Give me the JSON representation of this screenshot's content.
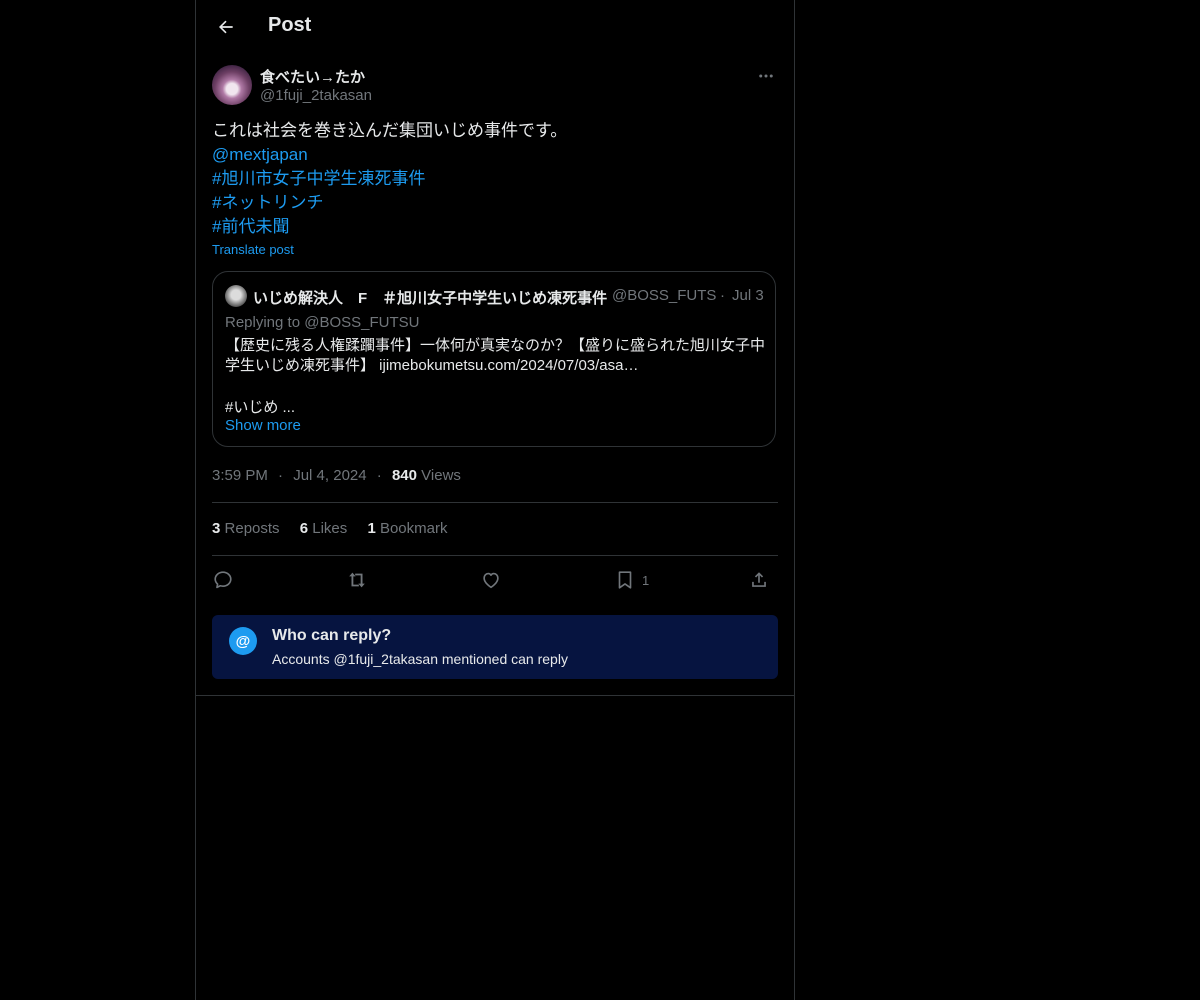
{
  "header": {
    "title": "Post"
  },
  "author": {
    "display_name": "食べたい→たか",
    "handle": "@1fuji_2takasan"
  },
  "post": {
    "lines": [
      "これは社会を巻き込んだ集団いじめ事件です。",
      "@mextjapan",
      "#旭川市女子中学生凍死事件",
      "#ネットリンチ",
      "#前代未聞"
    ],
    "translate_label": "Translate post"
  },
  "quote": {
    "name": "いじめ解決人　F　＃旭川女子中学生いじめ凍死事件",
    "handle": "@BOSS_FUTSU",
    "separator": "·",
    "date": "Jul 3",
    "replying": "Replying to @BOSS_FUTSU",
    "text_lines": [
      "【歴史に残る人権蹂躙事件】一体何が真実なのか？【盛りに盛られた旭川女子中",
      "学生いじめ凍死事件】 ijimebokumetsu.com/2024/07/03/asa…"
    ],
    "hashtag_line": "#いじめ ...",
    "show_more": "Show more"
  },
  "meta": {
    "time": "3:59 PM",
    "sep1": "·",
    "date": "Jul 4, 2024",
    "sep2": "·",
    "views_count": "840",
    "views_label": "Views"
  },
  "stats": {
    "reposts_count": "3",
    "reposts_label": "Reposts",
    "likes_count": "6",
    "likes_label": "Likes",
    "bookmarks_count": "1",
    "bookmarks_label": "Bookmark"
  },
  "actions": {
    "bookmark_count": "1"
  },
  "reply_info": {
    "icon": "@",
    "title": "Who can reply?",
    "subtitle": "Accounts @1fuji_2takasan mentioned can reply"
  },
  "colors": {
    "accent": "#1d9bf0",
    "muted": "#71767b",
    "reply_box_bg": "#061440"
  }
}
